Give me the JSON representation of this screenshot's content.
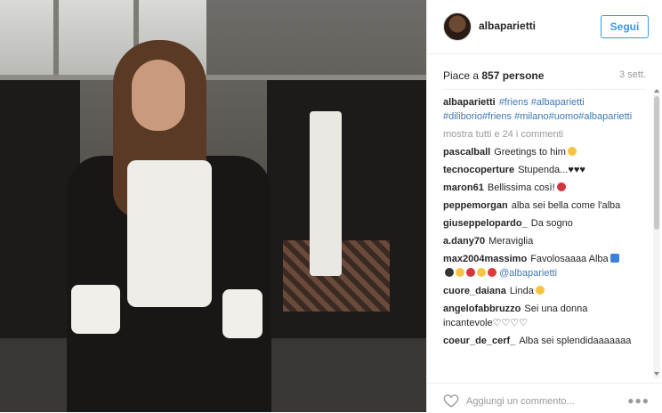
{
  "post": {
    "username": "albaparietti",
    "follow_label": "Segui",
    "likes_prefix": "Piace a ",
    "likes_count": "857 persone",
    "date": "3 sett.",
    "caption_hashtags": "#friens #albaparietti #diliborio#friens #milano#uomo#albaparietti",
    "show_all_comments": "mostra tutti e 24 i commenti",
    "add_comment_placeholder": "Aggiungi un commento...",
    "more_icon": "more-options-icon"
  },
  "comments": [
    {
      "user": "pascalball",
      "text": "Greetings to him"
    },
    {
      "user": "tecnocoperture",
      "text": "Stupenda..."
    },
    {
      "user": "maron61",
      "text": "Bellissima così!"
    },
    {
      "user": "peppemorgan",
      "text": "alba sei bella come l'alba"
    },
    {
      "user": "giuseppelopardo_",
      "text": "Da sogno"
    },
    {
      "user": "a.dany70",
      "text": "Meraviglia"
    },
    {
      "user": "max2004massimo",
      "text": "Favolosaaaa Alba"
    },
    {
      "user": "",
      "text": "@albaparietti"
    },
    {
      "user": "cuore_daiana",
      "text": "Linda"
    },
    {
      "user": "angelofabbruzzo",
      "text": "Sei una donna incantevole♡♡♡♡"
    },
    {
      "user": "coeur_de_cerf_",
      "text": "Alba sei splendidaaaaaaa"
    }
  ],
  "colors": {
    "accent": "#3897f0",
    "link": "#3e79b4"
  }
}
